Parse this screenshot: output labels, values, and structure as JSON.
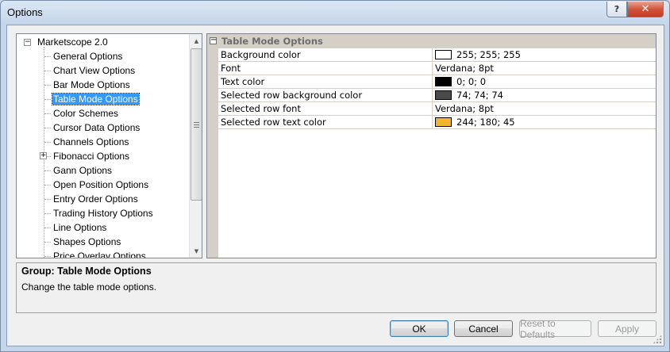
{
  "window": {
    "title": "Options",
    "help_glyph": "?",
    "close_glyph": "✕"
  },
  "tree": {
    "root_label": "Marketscope 2.0",
    "root_toggle": "−",
    "items": [
      {
        "label": "General Options",
        "has_children": false,
        "selected": false
      },
      {
        "label": "Chart View Options",
        "has_children": false,
        "selected": false
      },
      {
        "label": "Bar Mode Options",
        "has_children": false,
        "selected": false
      },
      {
        "label": "Table Mode Options",
        "has_children": false,
        "selected": true
      },
      {
        "label": "Color Schemes",
        "has_children": false,
        "selected": false
      },
      {
        "label": "Cursor Data Options",
        "has_children": false,
        "selected": false
      },
      {
        "label": "Channels Options",
        "has_children": false,
        "selected": false
      },
      {
        "label": "Fibonacci Options",
        "has_children": true,
        "selected": false
      },
      {
        "label": "Gann Options",
        "has_children": false,
        "selected": false
      },
      {
        "label": "Open Position Options",
        "has_children": false,
        "selected": false
      },
      {
        "label": "Entry Order Options",
        "has_children": false,
        "selected": false
      },
      {
        "label": "Trading History Options",
        "has_children": false,
        "selected": false
      },
      {
        "label": "Line Options",
        "has_children": false,
        "selected": false
      },
      {
        "label": "Shapes Options",
        "has_children": false,
        "selected": false
      },
      {
        "label": "Price Overlay Options",
        "has_children": false,
        "selected": false
      }
    ],
    "expand_glyph": "+"
  },
  "grid": {
    "category_label": "Table Mode Options",
    "category_toggle": "−",
    "rows": [
      {
        "name": "Background color",
        "value": "255; 255; 255",
        "swatch": "#ffffff"
      },
      {
        "name": "Font",
        "value": "Verdana; 8pt",
        "swatch": null
      },
      {
        "name": "Text color",
        "value": "0; 0; 0",
        "swatch": "#000000"
      },
      {
        "name": "Selected row background color",
        "value": "74; 74; 74",
        "swatch": "#4a4a4a"
      },
      {
        "name": "Selected row font",
        "value": "Verdana; 8pt",
        "swatch": null
      },
      {
        "name": "Selected row text color",
        "value": "244; 180; 45",
        "swatch": "#f4b42d"
      }
    ]
  },
  "description": {
    "title": "Group: Table Mode Options",
    "text": "Change the table mode options."
  },
  "buttons": {
    "ok": "OK",
    "cancel": "Cancel",
    "reset": "Reset to Defaults",
    "apply": "Apply"
  }
}
